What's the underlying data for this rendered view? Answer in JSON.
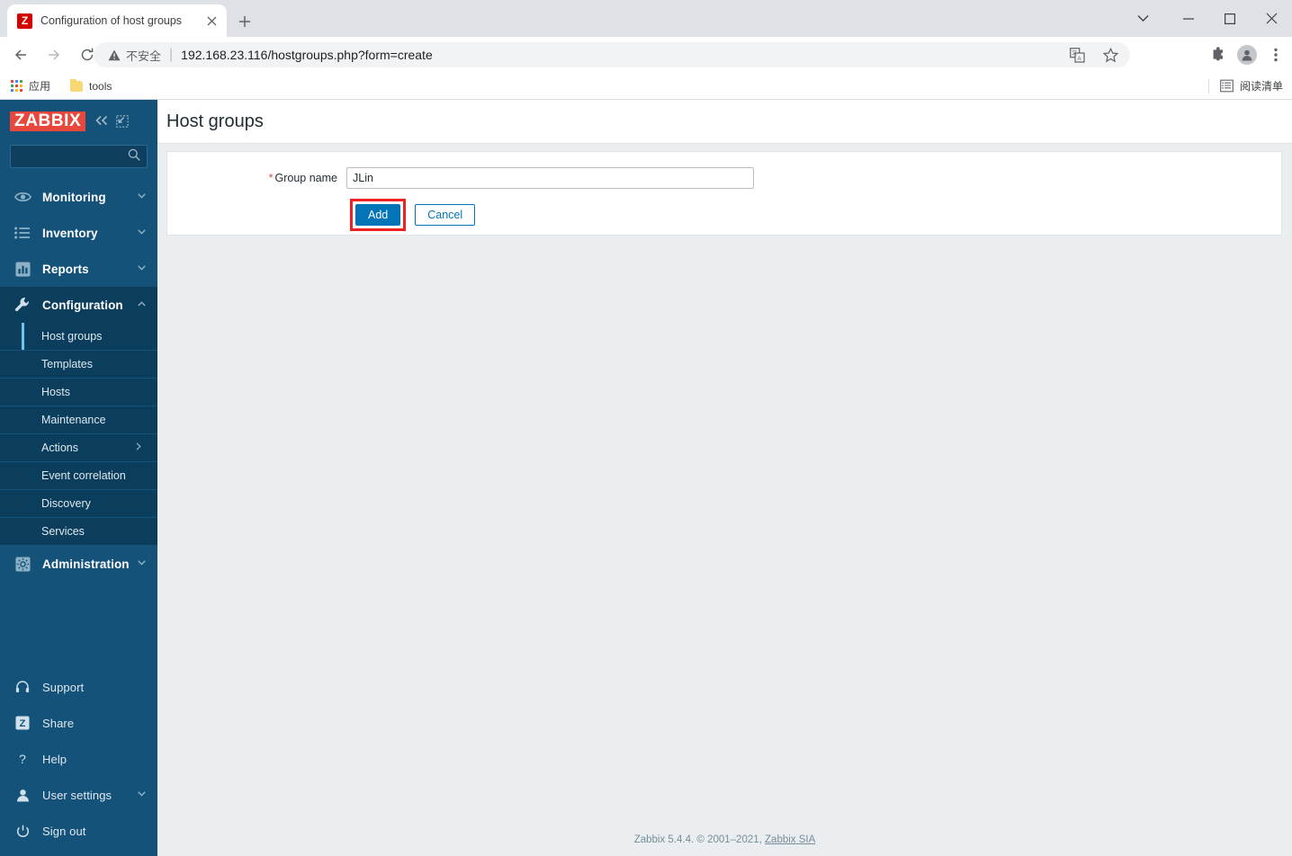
{
  "browser": {
    "tab": {
      "title": "Configuration of host groups",
      "favicon_letter": "Z",
      "favicon_icon": "zabbix-favicon",
      "close_icon": "close-icon"
    },
    "new_tab_icon": "plus-icon",
    "window_controls": {
      "caret_icon": "chevron-down-icon",
      "minimize_icon": "minimize-icon",
      "maximize_icon": "maximize-icon",
      "close_icon": "close-icon"
    },
    "nav": {
      "back_icon": "back-arrow-icon",
      "forward_icon": "forward-arrow-icon",
      "reload_icon": "reload-icon"
    },
    "omnibox": {
      "warning_icon": "not-secure-warning-icon",
      "warning_text": "不安全",
      "separator": "|",
      "url": "192.168.23.116/hostgroups.php?form=create",
      "translate_icon": "translate-icon",
      "bookmark_icon": "star-icon"
    },
    "toolbar": {
      "extensions_icon": "puzzle-extensions-icon",
      "profile_icon": "profile-avatar-icon",
      "menu_icon": "three-dot-menu-icon"
    },
    "bookmarks": [
      {
        "label": "应用",
        "icon": "apps-grid-icon"
      },
      {
        "label": "tools",
        "icon": "folder-icon"
      }
    ],
    "reading_list": {
      "label": "阅读清单",
      "icon": "reading-list-icon"
    }
  },
  "sidebar": {
    "logo": "ZABBIX",
    "collapse_icon": "double-chevron-left-icon",
    "hide_icon": "collapse-sidebar-icon",
    "search": {
      "value": "",
      "placeholder": "",
      "icon": "search-icon"
    },
    "menu": [
      {
        "label": "Monitoring",
        "icon": "eye-icon",
        "chevron": "chevron-down-icon",
        "expanded": false
      },
      {
        "label": "Inventory",
        "icon": "list-icon",
        "chevron": "chevron-down-icon",
        "expanded": false
      },
      {
        "label": "Reports",
        "icon": "bar-chart-icon",
        "chevron": "chevron-down-icon",
        "expanded": false
      },
      {
        "label": "Configuration",
        "icon": "wrench-icon",
        "chevron": "chevron-up-icon",
        "expanded": true
      },
      {
        "label": "Administration",
        "icon": "gear-cog-icon",
        "chevron": "chevron-down-icon",
        "expanded": false
      }
    ],
    "configuration_submenu": [
      {
        "label": "Host groups",
        "selected": true,
        "arrow": ""
      },
      {
        "label": "Templates",
        "selected": false,
        "arrow": ""
      },
      {
        "label": "Hosts",
        "selected": false,
        "arrow": ""
      },
      {
        "label": "Maintenance",
        "selected": false,
        "arrow": ""
      },
      {
        "label": "Actions",
        "selected": false,
        "arrow": "chevron-right-icon"
      },
      {
        "label": "Event correlation",
        "selected": false,
        "arrow": ""
      },
      {
        "label": "Discovery",
        "selected": false,
        "arrow": ""
      },
      {
        "label": "Services",
        "selected": false,
        "arrow": ""
      }
    ],
    "bottom_menu": [
      {
        "label": "Support",
        "icon": "headset-icon",
        "chevron": ""
      },
      {
        "label": "Share",
        "icon": "zabbix-share-icon",
        "chevron": ""
      },
      {
        "label": "Help",
        "icon": "question-mark-icon",
        "chevron": ""
      },
      {
        "label": "User settings",
        "icon": "user-icon",
        "chevron": "chevron-down-icon"
      },
      {
        "label": "Sign out",
        "icon": "power-icon",
        "chevron": ""
      }
    ]
  },
  "main": {
    "page_title": "Host groups",
    "form": {
      "group_name_label": "Group name",
      "group_name_required_marker": "*",
      "group_name_value": "JLin",
      "group_name_placeholder": "",
      "add_button": "Add",
      "cancel_button": "Cancel"
    }
  },
  "footer": {
    "text": "Zabbix 5.4.4. © 2001–2021, ",
    "link": "Zabbix SIA"
  },
  "colors": {
    "zabbix_red": "#e8483c",
    "sidebar_bg": "#14527a",
    "sidebar_sub_bg": "#0b3d5c",
    "accent_blue": "#0275b8",
    "selected_marker": "#6ec6f0",
    "highlight_box": "#ee2222",
    "content_bg": "#eaeef1"
  }
}
